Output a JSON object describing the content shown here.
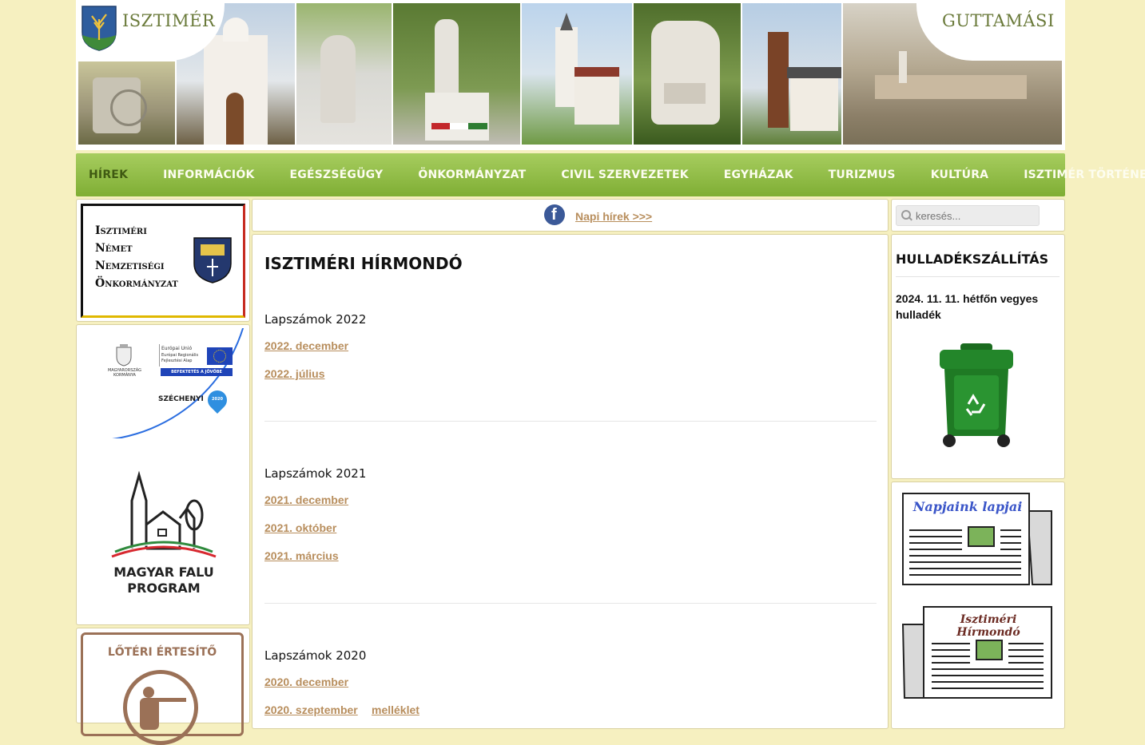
{
  "header": {
    "left_title": "ISZTIMÉR",
    "right_title": "GUTTAMÁSI"
  },
  "nav": {
    "items": [
      {
        "label": "HÍREK",
        "active": true
      },
      {
        "label": "INFORMÁCIÓK",
        "active": false
      },
      {
        "label": "EGÉSZSÉGÜGY",
        "active": false
      },
      {
        "label": "ÖNKORMÁNYZAT",
        "active": false
      },
      {
        "label": "CIVIL SZERVEZETEK",
        "active": false
      },
      {
        "label": "EGYHÁZAK",
        "active": false
      },
      {
        "label": "TURIZMUS",
        "active": false
      },
      {
        "label": "KULTÚRA",
        "active": false
      },
      {
        "label": "ISZTIMÉR TÖRTÉNETE",
        "active": false
      }
    ]
  },
  "left_sidebar": {
    "german_banner": {
      "lines": [
        "Isztiméri",
        "Német",
        "Nemzetiségi",
        "Önkormányzat"
      ]
    },
    "eu_banner": {
      "gov_label": "MAGYARORSZÁG KORMÁNYA",
      "eu_label": "Európai Unió",
      "eu_fund_line1": "Európai Regionális",
      "eu_fund_line2": "Fejlesztési Alap",
      "invest_label": "BEFEKTETÉS A JÖVŐBE",
      "szechenyi_label": "SZÉCHENYI",
      "szechenyi_year": "2020"
    },
    "village_program": {
      "line1": "MAGYAR FALU",
      "line2": "PROGRAM"
    },
    "shooting_notice": {
      "title": "LŐTÉRI ÉRTESÍTŐ"
    }
  },
  "topbar": {
    "daily_news_link": "Napi hírek >>>"
  },
  "main": {
    "title": "ISZTIMÉRI HÍRMONDÓ",
    "sections": [
      {
        "heading": "Lapszámok 2022",
        "links": [
          "2022. december",
          "2022. július"
        ]
      },
      {
        "heading": "Lapszámok 2021",
        "links": [
          "2021. december",
          "2021. október",
          "2021. március"
        ]
      },
      {
        "heading": "Lapszámok 2020",
        "links": [
          "2020. december",
          "2020. szeptember",
          "melléklet"
        ]
      }
    ]
  },
  "right_sidebar": {
    "search_placeholder": "keresés...",
    "waste": {
      "title": "HULLADÉKSZÁLLÍTÁS",
      "notice": "2024. 11. 11. hétfőn vegyes hulladék"
    },
    "papers": [
      {
        "title": "Napjaink lapjai"
      },
      {
        "title": "Isztiméri Hírmondó"
      }
    ]
  },
  "colors": {
    "page_bg": "#f6f0c0",
    "nav_green": "#8dbb42",
    "link_brown": "#b88e5d",
    "title_green": "#6a7a3a"
  }
}
